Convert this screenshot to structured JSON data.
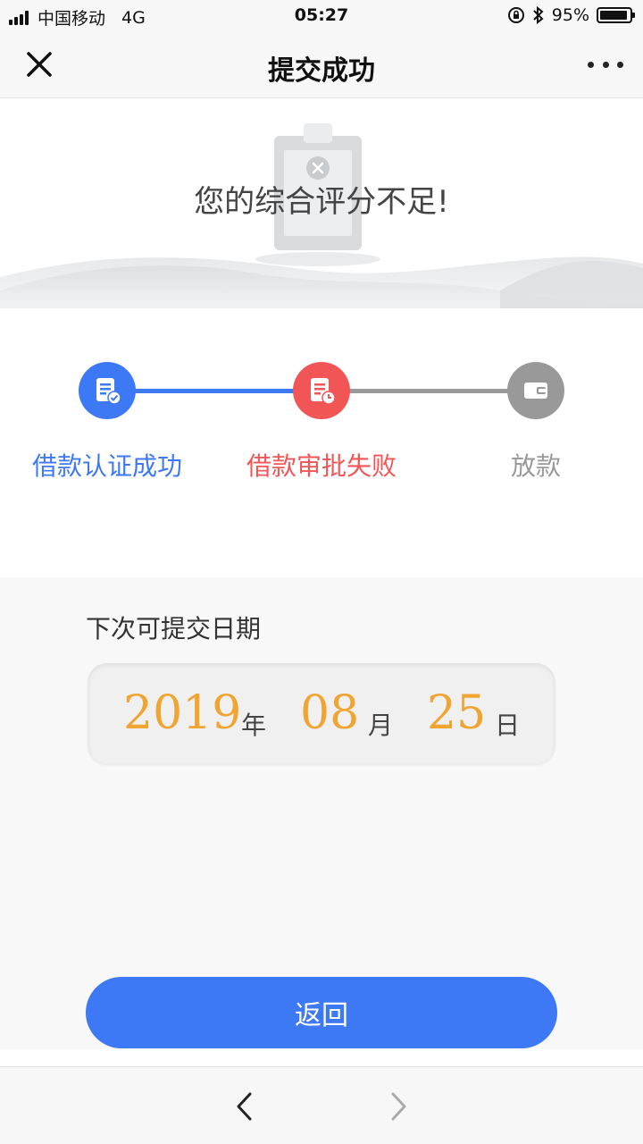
{
  "status_bar": {
    "carrier": "中国移动",
    "network": "4G",
    "time": "05:27",
    "battery": "95%",
    "battery_level": 0.95
  },
  "nav": {
    "title": "提交成功",
    "close_icon": "close-icon",
    "more_icon": "more-icon"
  },
  "banner": {
    "message": "您的综合评分不足!"
  },
  "steps": [
    {
      "label": "借款认证成功",
      "state": "done",
      "color": "#3d78f5"
    },
    {
      "label": "借款审批失败",
      "state": "failed",
      "color": "#f25555"
    },
    {
      "label": "放款",
      "state": "pending",
      "color": "#999999"
    }
  ],
  "next_date": {
    "title": "下次可提交日期",
    "year": "2019",
    "year_unit": "年",
    "month": "08",
    "month_unit": "月",
    "day": "25",
    "day_unit": "日"
  },
  "actions": {
    "back_label": "返回"
  },
  "colors": {
    "accent": "#3d78f5",
    "error": "#f25555",
    "date_highlight": "#f0a431",
    "inactive": "#999999"
  }
}
